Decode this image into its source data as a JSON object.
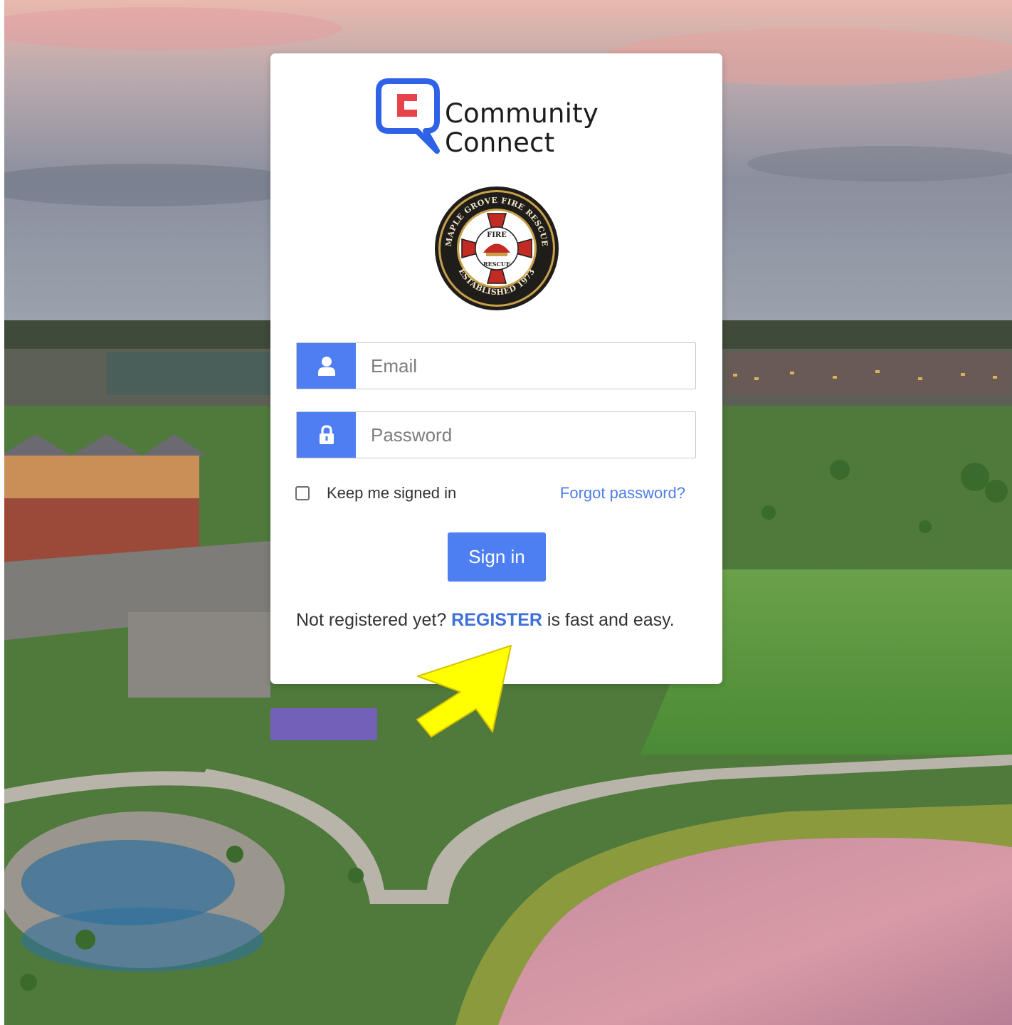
{
  "brand": {
    "line1": "Community",
    "line2": "Connect",
    "icon_color_red": "#e8424a",
    "icon_color_blue": "#2e63e8"
  },
  "seal": {
    "ring_text_top": "MAPLE GROVE FIRE RESCUE",
    "ring_text_bottom": "ESTABLISHED 1973",
    "center_top": "FIRE",
    "center_bottom": "RESCUE"
  },
  "form": {
    "email_placeholder": "Email",
    "email_icon": "user-icon",
    "password_placeholder": "Password",
    "password_icon": "lock-icon",
    "remember_label": "Keep me signed in",
    "remember_checked": false,
    "forgot_label": "Forgot password?",
    "signin_label": "Sign in",
    "accent_color": "#4f7ef2"
  },
  "register": {
    "prefix": "Not registered yet? ",
    "link": "REGISTER",
    "suffix": " is fast and easy."
  },
  "annotation": {
    "arrow_color": "#ffff00"
  }
}
